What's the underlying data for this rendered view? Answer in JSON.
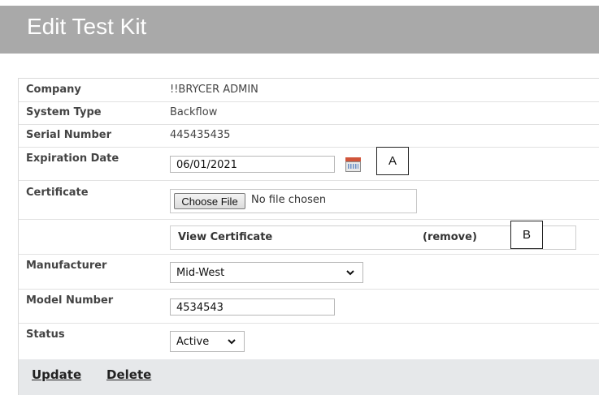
{
  "page": {
    "title": "Edit Test Kit"
  },
  "fields": {
    "company": {
      "label": "Company",
      "value": "!!BRYCER ADMIN"
    },
    "system_type": {
      "label": "System Type",
      "value": "Backflow"
    },
    "serial_number": {
      "label": "Serial Number",
      "value": "445435435"
    },
    "expiration_date": {
      "label": "Expiration Date",
      "value": "06/01/2021"
    },
    "certificate": {
      "label": "Certificate",
      "choose_button": "Choose File",
      "no_file": "No file chosen"
    },
    "certificate_link": {
      "view": "View Certificate",
      "remove": "(remove)"
    },
    "manufacturer": {
      "label": "Manufacturer",
      "selected": "Mid-West"
    },
    "model_number": {
      "label": "Model Number",
      "value": "4534543"
    },
    "status": {
      "label": "Status",
      "selected": "Active"
    }
  },
  "actions": {
    "update": "Update",
    "delete": "Delete"
  },
  "callouts": {
    "a": "A",
    "b": "B"
  },
  "icons": {
    "calendar": "calendar-icon",
    "chevron": "chevron-down-icon"
  },
  "colors": {
    "header_bg": "#a9a9a9",
    "footer_bg": "#e6e8ea"
  }
}
